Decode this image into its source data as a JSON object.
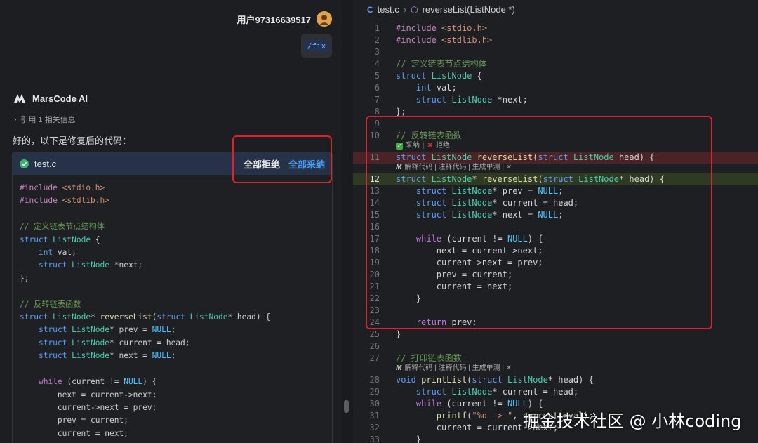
{
  "chat": {
    "user_name": "用户97316639517",
    "command_chip": "/fix",
    "ai_name": "MarsCode AI",
    "reference_label": "引用 1 相关信息",
    "reply_intro": "好的，以下是修复后的代码：",
    "code_card": {
      "filename": "test.c",
      "reject_all": "全部拒绝",
      "accept_all": "全部采纳",
      "code": "#include <stdio.h>\n#include <stdlib.h>\n\n// 定义链表节点结构体\nstruct ListNode {\n    int val;\n    struct ListNode *next;\n};\n\n// 反转链表函数\nstruct ListNode* reverseList(struct ListNode* head) {\n    struct ListNode* prev = NULL;\n    struct ListNode* current = head;\n    struct ListNode* next = NULL;\n\n    while (current != NULL) {\n        next = current->next;\n        current->next = prev;\n        prev = current;\n        current = next;"
    }
  },
  "editor": {
    "breadcrumb_file": "test.c",
    "breadcrumb_symbol": "reverseList(ListNode *)",
    "lens_accept": "采纳",
    "lens_reject": "拒绝",
    "lens_actions": "解释代码 | 注释代码 | 生成单测 | ✕",
    "lines": [
      {
        "n": "1",
        "text": "#include <stdio.h>"
      },
      {
        "n": "2",
        "text": "#include <stdlib.h>"
      },
      {
        "n": "3",
        "text": ""
      },
      {
        "n": "4",
        "text": "// 定义链表节点结构体"
      },
      {
        "n": "5",
        "text": "struct ListNode {"
      },
      {
        "n": "6",
        "text": "    int val;"
      },
      {
        "n": "7",
        "text": "    struct ListNode *next;"
      },
      {
        "n": "8",
        "text": "};"
      },
      {
        "n": "9",
        "text": ""
      },
      {
        "n": "10",
        "text": "// 反转链表函数"
      },
      {
        "n": "11",
        "text": "struct ListNode reverseList(struct ListNode head) {"
      },
      {
        "n": "12",
        "text": "struct ListNode* reverseList(struct ListNode* head) {"
      },
      {
        "n": "13",
        "text": "    struct ListNode* prev = NULL;"
      },
      {
        "n": "14",
        "text": "    struct ListNode* current = head;"
      },
      {
        "n": "15",
        "text": "    struct ListNode* next = NULL;"
      },
      {
        "n": "16",
        "text": ""
      },
      {
        "n": "17",
        "text": "    while (current != NULL) {"
      },
      {
        "n": "18",
        "text": "        next = current->next;"
      },
      {
        "n": "19",
        "text": "        current->next = prev;"
      },
      {
        "n": "20",
        "text": "        prev = current;"
      },
      {
        "n": "21",
        "text": "        current = next;"
      },
      {
        "n": "22",
        "text": "    }"
      },
      {
        "n": "23",
        "text": ""
      },
      {
        "n": "24",
        "text": "    return prev;"
      },
      {
        "n": "25",
        "text": "}"
      },
      {
        "n": "26",
        "text": ""
      },
      {
        "n": "27",
        "text": "// 打印链表函数"
      },
      {
        "n": "28",
        "text": "void printList(struct ListNode* head) {"
      },
      {
        "n": "29",
        "text": "    struct ListNode* current = head;"
      },
      {
        "n": "30",
        "text": "    while (current != NULL) {"
      },
      {
        "n": "31",
        "text": "        printf(\"%d -> \", current->val);"
      },
      {
        "n": "32",
        "text": "        current = current->next;"
      },
      {
        "n": "33",
        "text": "    }"
      }
    ]
  },
  "watermark": "掘金技术社区 @ 小林coding",
  "colors": {
    "accent": "#4a9dff",
    "highlight_box": "#e0202a",
    "deleted_bg": "#4a2327",
    "added_bg": "#2f3a22"
  }
}
